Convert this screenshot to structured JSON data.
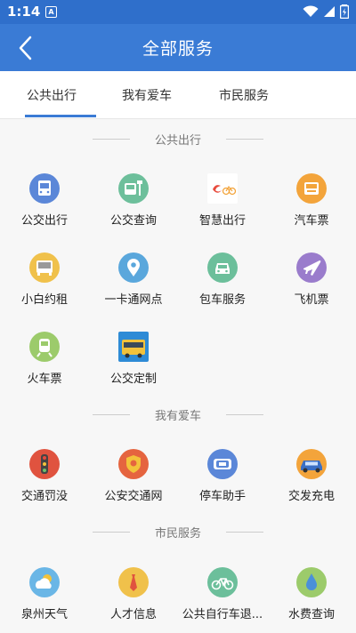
{
  "status": {
    "time": "1:14",
    "notification_glyph": "A"
  },
  "header": {
    "title": "全部服务"
  },
  "tabs": [
    {
      "label": "公共出行",
      "active": true
    },
    {
      "label": "我有爱车",
      "active": false
    },
    {
      "label": "市民服务",
      "active": false
    }
  ],
  "sections": [
    {
      "title": "公共出行",
      "items": [
        {
          "label": "公交出行",
          "icon": "bus-icon",
          "color": "#5b87d8"
        },
        {
          "label": "公交查询",
          "icon": "bus-stop-icon",
          "color": "#6dbf9b"
        },
        {
          "label": "智慧出行",
          "icon": "smart-travel-logo-icon",
          "color": "#e84a3c"
        },
        {
          "label": "汽车票",
          "icon": "ticket-icon",
          "color": "#f3a43b"
        },
        {
          "label": "小白约租",
          "icon": "taxi-icon",
          "color": "#f0c14b"
        },
        {
          "label": "一卡通网点",
          "icon": "location-pin-icon",
          "color": "#5aa7dc"
        },
        {
          "label": "包车服务",
          "icon": "car-icon",
          "color": "#6cbf9b"
        },
        {
          "label": "飞机票",
          "icon": "airplane-icon",
          "color": "#9a7ccc"
        },
        {
          "label": "火车票",
          "icon": "train-icon",
          "color": "#9ccb6b"
        },
        {
          "label": "公交定制",
          "icon": "custom-bus-icon",
          "color": "#2e8bd6"
        }
      ]
    },
    {
      "title": "我有爱车",
      "items": [
        {
          "label": "交通罚没",
          "icon": "traffic-light-icon",
          "color": "#e0533f"
        },
        {
          "label": "公安交通网",
          "icon": "police-badge-icon",
          "color": "#e5643f"
        },
        {
          "label": "停车助手",
          "icon": "parking-icon",
          "color": "#5b87d8"
        },
        {
          "label": "交发充电",
          "icon": "charging-car-icon",
          "color": "#f3a43b"
        }
      ]
    },
    {
      "title": "市民服务",
      "items": [
        {
          "label": "泉州天气",
          "icon": "weather-icon",
          "color": "#6ab6e6"
        },
        {
          "label": "人才信息",
          "icon": "tie-icon",
          "color": "#f0c14b"
        },
        {
          "label": "公共自行车退...",
          "icon": "bicycle-icon",
          "color": "#6cbf9b"
        },
        {
          "label": "水费查询",
          "icon": "water-drop-icon",
          "color": "#9ccb6b"
        }
      ]
    }
  ]
}
